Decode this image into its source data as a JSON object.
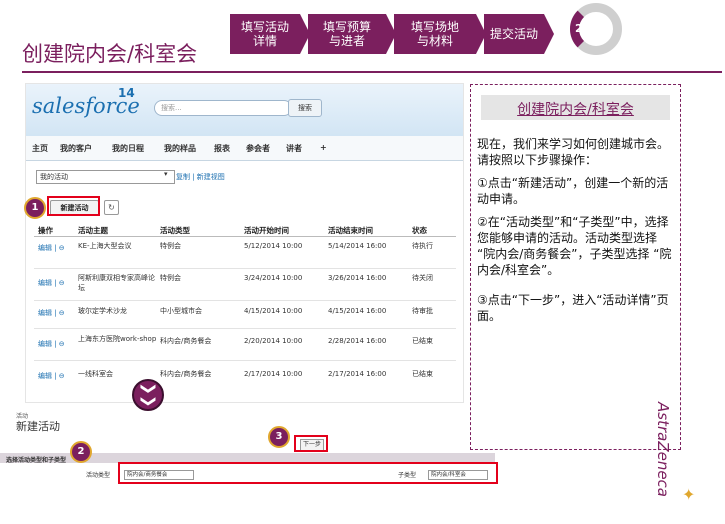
{
  "page_title": "创建院内会/科室会",
  "steps": [
    {
      "label_line1": "填写活动",
      "label_line2": "详情"
    },
    {
      "label_line1": "填写预算",
      "label_line2": "与进者"
    },
    {
      "label_line1": "填写场地",
      "label_line2": "与材料"
    },
    {
      "label_line1": "提交活动",
      "label_line2": ""
    }
  ],
  "step_indicator": "2",
  "salesforce": {
    "logo": "salesforce",
    "version": "14",
    "search_placeholder": "搜索...",
    "search_button": "搜索",
    "nav": [
      "主页",
      "我的客户",
      "我的日程",
      "我的样品",
      "报表",
      "参会者",
      "讲者",
      "+"
    ],
    "view_select": "我的活动",
    "view_links": "复制 | 新建视图",
    "new_button": "新建活动",
    "refresh_icon": "↻",
    "columns": [
      "操作",
      "活动主题",
      "活动类型",
      "活动开始时间",
      "活动结束时间",
      "状态"
    ],
    "rows": [
      {
        "action": "编辑 | ⊖",
        "subject": "KE-上海大型会议",
        "type": "特例会",
        "start": "5/12/2014 10:00",
        "end": "5/14/2014 16:00",
        "status": "待执行"
      },
      {
        "action": "编辑 | ⊖",
        "subject": "阿斯利康双相专家高峰论坛",
        "type": "特例会",
        "start": "3/24/2014 10:00",
        "end": "3/26/2014 16:00",
        "status": "待关闭"
      },
      {
        "action": "编辑 | ⊖",
        "subject": "玻尔定学术沙龙",
        "type": "中小型城市会",
        "start": "4/15/2014 10:00",
        "end": "4/15/2014 16:00",
        "status": "待审批"
      },
      {
        "action": "编辑 | ⊖",
        "subject": "上海东方医院work-shop",
        "type": "科内会/商务餐会",
        "start": "2/20/2014 10:00",
        "end": "2/28/2014 16:00",
        "status": "已结束"
      },
      {
        "action": "编辑 | ⊖",
        "subject": "一线科室会",
        "type": "科内会/商务餐会",
        "start": "2/17/2014 10:00",
        "end": "2/17/2014 16:00",
        "status": "已结束"
      }
    ],
    "new_activity_small": "活动",
    "new_activity_title": "新建活动",
    "next_button": "下一步",
    "section_title": "选择活动类型和子类型",
    "type_label": "活动类型",
    "type_value": "院内会/商务餐会",
    "subtype_label": "子类型",
    "subtype_value": "院内会/科室会"
  },
  "markers": [
    "1",
    "2",
    "3"
  ],
  "chevron_icon": "❯❯",
  "panel": {
    "title": "创建院内会/科室会",
    "intro": "现在，我们来学习如何创建城市会。请按照以下步骤操作：",
    "step1": "①点击“新建活动”，创建一个新的活动申请。",
    "step2": "②在“活动类型”和“子类型”中，选择您能够申请的活动。活动类型选择 “院内会/商务餐会”，子类型选择 “院内会/科室会”。",
    "step3": "③点击“下一步”，进入“活动详情”页面。"
  },
  "brand": "AstraZeneca"
}
